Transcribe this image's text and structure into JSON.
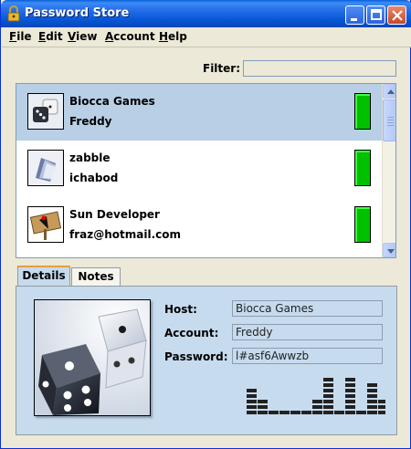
{
  "window": {
    "title": "Password Store"
  },
  "menu": [
    "File",
    "Edit",
    "View",
    "Account",
    "Help"
  ],
  "filter": {
    "label": "Filter:",
    "value": ""
  },
  "entries": [
    {
      "title": "Biocca Games",
      "subtitle": "Freddy",
      "selected": true,
      "icon": "dice-icon",
      "strength_color": "#00c000"
    },
    {
      "title": "zabble",
      "subtitle": "ichabod",
      "selected": false,
      "icon": "cards-icon",
      "strength_color": "#00c000"
    },
    {
      "title": "Sun Developer",
      "subtitle": "fraz@hotmail.com",
      "selected": false,
      "icon": "duke-icon",
      "strength_color": "#00c000"
    }
  ],
  "tabs": [
    {
      "label": "Details",
      "active": true
    },
    {
      "label": "Notes",
      "active": false
    }
  ],
  "details": {
    "host_label": "Host:",
    "host_value": "Biocca Games",
    "account_label": "Account:",
    "account_value": "Freddy",
    "password_label": "Password:",
    "password_value": "l#asf6Awwzb",
    "image_icon": "dice-icon"
  },
  "strength_meter": {
    "levels": [
      5,
      3,
      1,
      1,
      1,
      1,
      3,
      7,
      1,
      7,
      1,
      6,
      3,
      1
    ],
    "max_level": 8
  },
  "colors": {
    "selection": "#b8cfe5",
    "panel": "#c7dbee",
    "strength": "#00c000",
    "titlebar": "#0758d8"
  }
}
